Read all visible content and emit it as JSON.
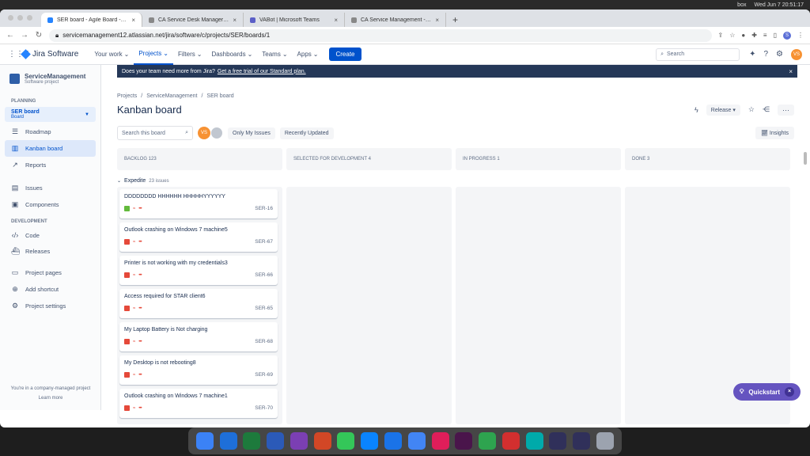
{
  "macbar": {
    "box": "box",
    "datetime": "Wed Jun 7  20:51:17"
  },
  "browser": {
    "tabs": [
      {
        "title": "SER board - Agile Board - Jira",
        "color": "#2684ff",
        "active": true
      },
      {
        "title": "CA Service Desk Manager - Ac",
        "color": "#888888",
        "active": false
      },
      {
        "title": "VABot | Microsoft Teams",
        "color": "#5b5fc7",
        "active": false
      },
      {
        "title": "CA Service Management - Hor",
        "color": "#888888",
        "active": false
      }
    ],
    "new_tab": "+",
    "url": "servicemanagement12.atlassian.net/jira/software/c/projects/SER/boards/1",
    "profile_initial": "S"
  },
  "jira_nav": {
    "product": "Jira Software",
    "items": [
      "Your work",
      "Projects",
      "Filters",
      "Dashboards",
      "Teams",
      "Apps"
    ],
    "selected": "Projects",
    "create": "Create",
    "search_placeholder": "Search",
    "avatar": "VS"
  },
  "sidebar": {
    "project_name": "ServiceManagement",
    "project_type": "Software project",
    "planning_heading": "PLANNING",
    "board_selector_title": "SER board",
    "board_selector_sub": "Board",
    "planning_items": [
      {
        "label": "Roadmap",
        "icon": "roadmap-icon",
        "glyph": "☰"
      },
      {
        "label": "Kanban board",
        "icon": "board-icon",
        "glyph": "▥",
        "selected": true
      },
      {
        "label": "Reports",
        "icon": "reports-icon",
        "glyph": "↗"
      }
    ],
    "other_items": [
      {
        "label": "Issues",
        "icon": "issues-icon",
        "glyph": "▤"
      },
      {
        "label": "Components",
        "icon": "components-icon",
        "glyph": "▣"
      }
    ],
    "development_heading": "DEVELOPMENT",
    "dev_items": [
      {
        "label": "Code",
        "icon": "code-icon",
        "glyph": "‹/›"
      },
      {
        "label": "Releases",
        "icon": "releases-icon",
        "glyph": "⛴"
      }
    ],
    "bottom_items": [
      {
        "label": "Project pages",
        "icon": "pages-icon",
        "glyph": "▭"
      },
      {
        "label": "Add shortcut",
        "icon": "shortcut-icon",
        "glyph": "⊕"
      },
      {
        "label": "Project settings",
        "icon": "settings-icon",
        "glyph": "⚙"
      }
    ],
    "footer_text": "You're in a company-managed project",
    "footer_link": "Learn more"
  },
  "banner": {
    "text": "Does your team need more from Jira?",
    "link": "Get a free trial of our Standard plan.",
    "close": "×"
  },
  "breadcrumbs": [
    "Projects",
    "ServiceManagement",
    "SER board"
  ],
  "page_title": "Kanban board",
  "actions": {
    "release": "Release",
    "more": "···"
  },
  "filters": {
    "search_placeholder": "Search this board",
    "avatar": "VS",
    "only_my_issues": "Only My Issues",
    "recently_updated": "Recently Updated",
    "insights": "Insights"
  },
  "columns": [
    "BACKLOG 123",
    "SELECTED FOR DEVELOPMENT 4",
    "IN PROGRESS 1",
    "DONE 3"
  ],
  "swimlane": {
    "name": "Expedite",
    "count": "23 issues"
  },
  "cards": [
    {
      "title": "DDDDDDDD HHHHHH HHHHHYYYYYY",
      "key": "SER-16",
      "type": "story"
    },
    {
      "title": "Outlook crashing on Windows 7 machine5",
      "key": "SER-67",
      "type": "bug"
    },
    {
      "title": "Printer is not working with my credentials3",
      "key": "SER-66",
      "type": "bug"
    },
    {
      "title": "Access required for STAR client6",
      "key": "SER-65",
      "type": "bug"
    },
    {
      "title": "My Laptop Battery is Not charging",
      "key": "SER-68",
      "type": "bug"
    },
    {
      "title": "My Desktop is not rebooting8",
      "key": "SER-69",
      "type": "bug"
    },
    {
      "title": "Outlook crashing on Windows 7 machine1",
      "key": "SER-70",
      "type": "bug"
    }
  ],
  "quickstart": {
    "label": "Quickstart",
    "close": "×"
  },
  "dock_colors": [
    "#3b82f6",
    "#1e6fd9",
    "#1d7a3c",
    "#2b5ab8",
    "#7b3fb3",
    "#d24726",
    "#34c759",
    "#0a84ff",
    "#1a73e8",
    "#4285f4",
    "#e01e5a",
    "#4a154b",
    "#2ea44f",
    "#d32f2f",
    "#0aa",
    "#30305a",
    "#30305a",
    "#9ca3af"
  ]
}
